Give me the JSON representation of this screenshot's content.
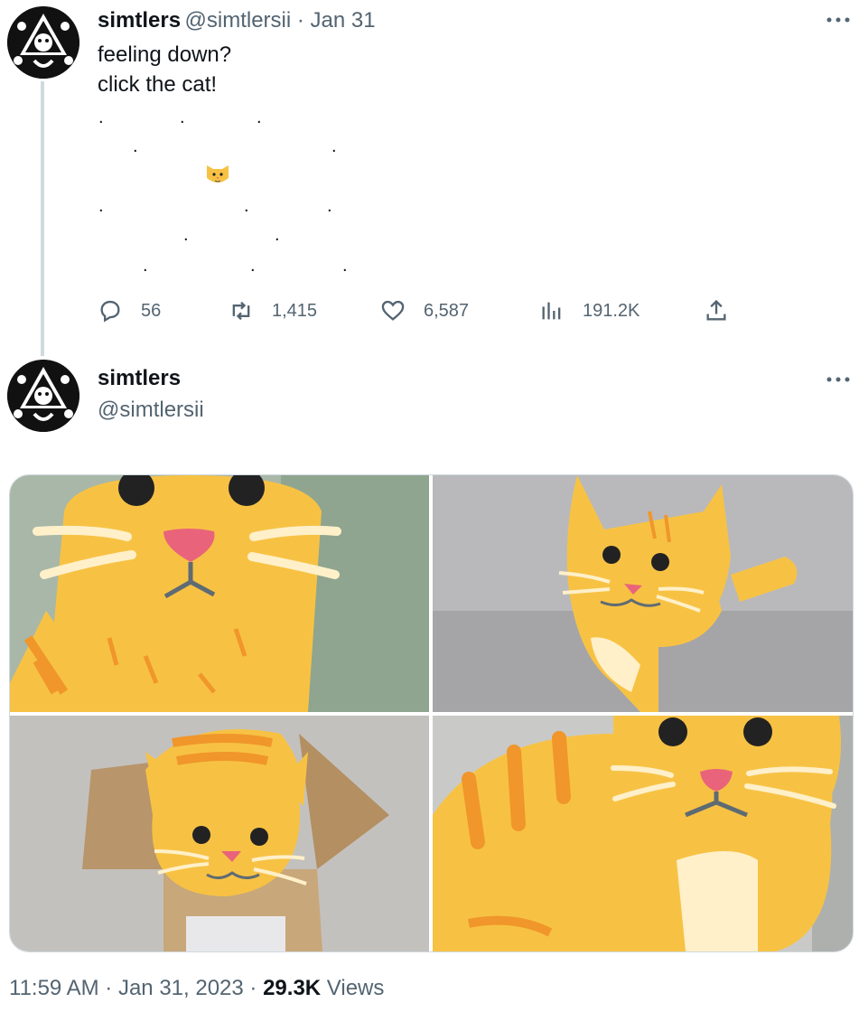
{
  "tweet1": {
    "name": "simtlers",
    "handle": "@simtlersii",
    "sep": " · ",
    "date": "Jan 31",
    "line1": "feeling down?",
    "line2": "click the cat!",
    "dot": ".",
    "cat": "🐱",
    "actions": {
      "replies": "56",
      "retweets": "1,415",
      "likes": "6,587",
      "views": "191.2K"
    }
  },
  "tweet2": {
    "name": "simtlers",
    "handle": "@simtlersii"
  },
  "meta": {
    "time": "11:59 AM",
    "sep": " · ",
    "date": "Jan 31, 2023",
    "sep2": " · ",
    "views_count": "29.3K",
    "views_label": " Views"
  },
  "icons": {
    "more": "more-icon",
    "reply": "reply-icon",
    "retweet": "retweet-icon",
    "like": "heart-icon",
    "views": "views-icon",
    "share": "share-icon"
  },
  "colors": {
    "cat_yellow": "#f7c244",
    "cat_stripe": "#f0962a",
    "nose": "#e9647a",
    "secondary_text": "#536471",
    "thread_line": "#cfd9de"
  }
}
